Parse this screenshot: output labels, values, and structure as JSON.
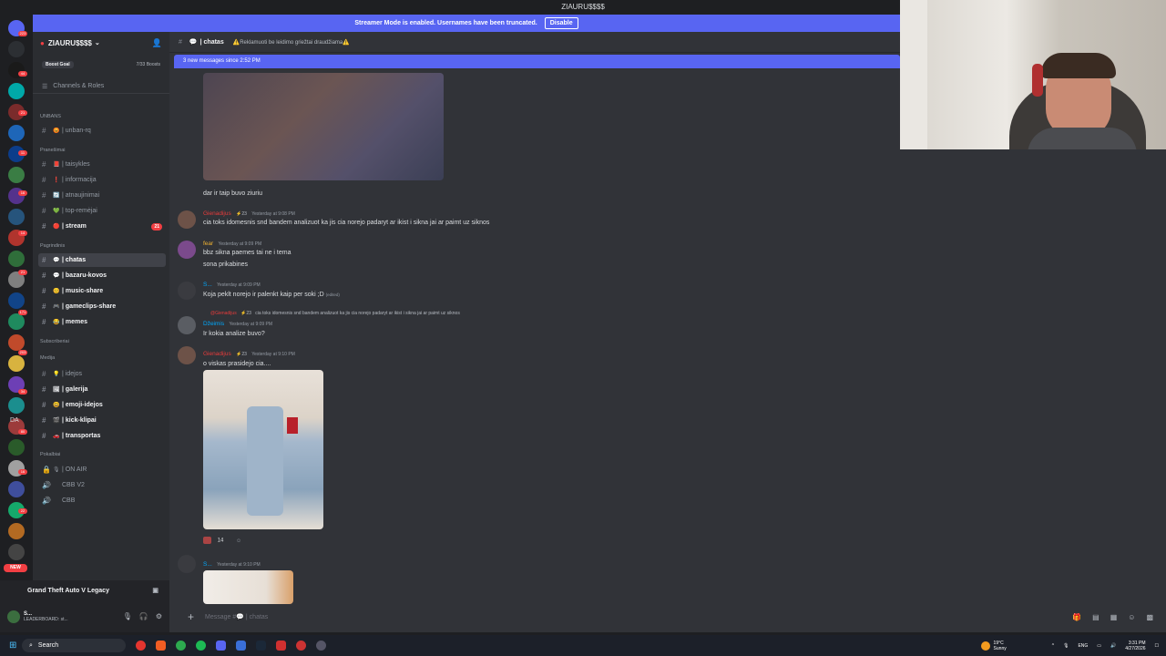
{
  "window": {
    "title": "ZIAURU$$$$"
  },
  "banner": {
    "text": "Streamer Mode is enabled. Usernames have been truncated.",
    "disable_label": "Disable"
  },
  "rail": {
    "badges": [
      "223",
      "44",
      "21",
      "11",
      "16",
      "14",
      "21",
      "171",
      "203",
      "34",
      "80",
      "16",
      "22"
    ],
    "da_label": "DA",
    "new_label": "NEW"
  },
  "sidebar": {
    "guild_name": "ZIAURU$$$$",
    "boost_goal_label": "Boost Goal",
    "boost_count": "7/33 Boosts",
    "channels_roles": "Channels & Roles",
    "categories": [
      "UNBANS",
      "Pranešimai",
      "Pagrindinis",
      "Subscriberiai",
      "Medija",
      "Pokalbiai"
    ],
    "channels": [
      {
        "name": "| unban-rq",
        "emoji": "😡"
      },
      {
        "name": "| taisykles",
        "emoji": "📕"
      },
      {
        "name": "| informacija",
        "emoji": "❗"
      },
      {
        "name": "| atnaujinimai",
        "emoji": "🔄"
      },
      {
        "name": "| top-remėjai",
        "emoji": "💚"
      },
      {
        "name": "| stream",
        "emoji": "🔴",
        "count": "21"
      },
      {
        "name": "| chatas",
        "emoji": "💬"
      },
      {
        "name": "| bazaru-kovos",
        "emoji": "💬"
      },
      {
        "name": "| music-share",
        "emoji": "😊"
      },
      {
        "name": "| gameclips-share",
        "emoji": "🎮"
      },
      {
        "name": "| memes",
        "emoji": "😂"
      },
      {
        "name": "| idejos",
        "emoji": "💡"
      },
      {
        "name": "| galerija",
        "emoji": "🖼"
      },
      {
        "name": "| emoji-idejos",
        "emoji": "😃"
      },
      {
        "name": "| kick-klipai",
        "emoji": "🎬"
      },
      {
        "name": "| transportas",
        "emoji": "🚗"
      },
      {
        "name": "| ON AIR",
        "emoji": "🎙"
      },
      {
        "name": "CBB V2",
        "emoji": ""
      },
      {
        "name": "CBB",
        "emoji": ""
      }
    ],
    "voice_activity": "Grand Theft Auto V Legacy",
    "user_name": "S...",
    "user_status": "LEADERBOARD: st..."
  },
  "chat": {
    "channel_name": "| chatas",
    "topic": "⚠️Reklamuoti be leidimo griežtai draudžiama⚠️",
    "new_messages": "3 new messages since 2:52 PM",
    "messages": [
      {
        "text": "dar ir taip buvo ziuriu"
      },
      {
        "author": "Gienadijus",
        "badge": "23",
        "time": "Yesterday at 9:08 PM",
        "text": "cia toks idomesnis snd bandem analizuot ka jis cia norejo padaryt ar ikist i sikna jai ar paimt uz siknos"
      },
      {
        "author": "fear",
        "time": "Yesterday at 9:09 PM",
        "text": "bbz sikna paemes tai ne i tema",
        "text2": "sona prikabines"
      },
      {
        "author": "S...",
        "time": "Yesterday at 9:09 PM",
        "text": "Koja peklt norejo ir palenkt kaip per soki ;D",
        "edited": "(edited)"
      },
      {
        "reply_author": "@Gienadijus",
        "reply_badge": "23",
        "reply_text": "cia toks idomesnis snd bandem analizuot ka jis cia norejo padaryt ar ikist i sikna jai ar paimt uz siknos",
        "author": "Džeimis",
        "time": "Yesterday at 9:09 PM",
        "text": "Ir kokia analize buvo?"
      },
      {
        "author": "Gienadijus",
        "badge": "23",
        "time": "Yesterday at 9:10 PM",
        "text": "o viskas prasidejo cia....",
        "reaction_count": "14"
      },
      {
        "author": "S...",
        "time": "Yesterday at 9:10 PM"
      }
    ],
    "composer_placeholder": "Message #💬 | chatas"
  },
  "taskbar": {
    "search_label": "Search",
    "weather_temp": "19°C",
    "weather_desc": "Sunny",
    "lang": "ENG",
    "time": "3:31 PM",
    "date": "4/27/2026"
  }
}
